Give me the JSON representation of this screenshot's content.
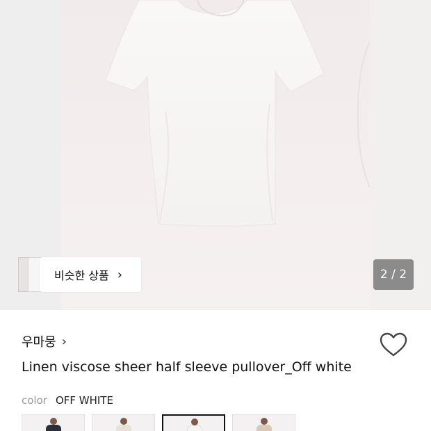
{
  "gallery": {
    "similar_label": "비슷한 상품",
    "pager": "2 / 2"
  },
  "product": {
    "brand": "우마뭉",
    "brand_chevron": "›",
    "title": "Linen viscose sheer half sleeve pullover_Off white",
    "color_label": "color",
    "color_value": "OFF WHITE",
    "swatches": [
      {
        "name": "black",
        "color": "#2a2f3a"
      },
      {
        "name": "light-beige",
        "color": "#e8e1d8"
      },
      {
        "name": "off-white",
        "color": "#f5f4f2",
        "selected": true
      },
      {
        "name": "beige",
        "color": "#d9c9b6"
      }
    ]
  },
  "icons": {
    "similar_chevron": "chevron-right-icon",
    "brand_chevron": "chevron-right-icon",
    "favorite": "heart-outline-icon"
  },
  "colors": {
    "hero_background": "#f2eeef",
    "pager_background": "#6e6e6e",
    "text": "#111111",
    "muted": "#999999"
  }
}
